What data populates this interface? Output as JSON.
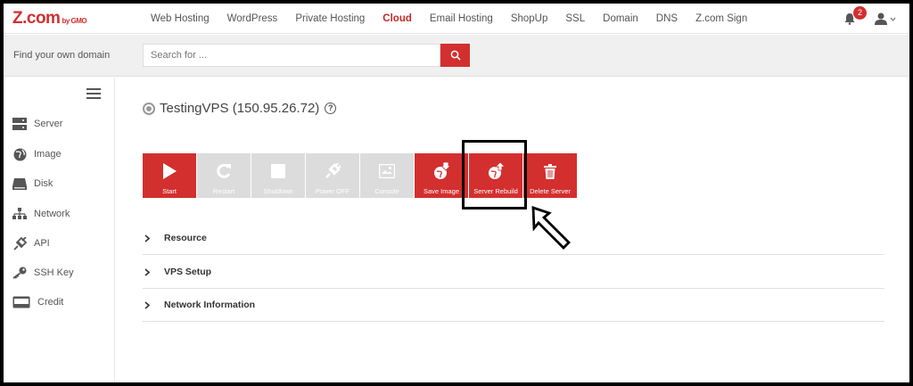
{
  "brand": {
    "logo": "Z.com",
    "logo_suffix": "by GMO"
  },
  "nav": {
    "items": [
      "Web Hosting",
      "WordPress",
      "Private Hosting",
      "Cloud",
      "Email Hosting",
      "ShopUp",
      "SSL",
      "Domain",
      "DNS",
      "Z.com Sign"
    ],
    "active": "Cloud",
    "notifications": "2"
  },
  "search": {
    "label": "Find your own domain",
    "placeholder": "Search for ..."
  },
  "sidebar": {
    "items": [
      {
        "label": "Server",
        "icon": "server-icon"
      },
      {
        "label": "Image",
        "icon": "globe-icon"
      },
      {
        "label": "Disk",
        "icon": "disk-icon"
      },
      {
        "label": "Network",
        "icon": "network-icon"
      },
      {
        "label": "API",
        "icon": "api-icon"
      },
      {
        "label": "SSH Key",
        "icon": "key-icon"
      },
      {
        "label": "Credit",
        "icon": "credit-card-icon"
      }
    ]
  },
  "vps": {
    "title": "TestingVPS (150.95.26.72)"
  },
  "toolbar": {
    "buttons": [
      {
        "label": "Start",
        "enabled": true,
        "icon": "play-icon"
      },
      {
        "label": "Restart",
        "enabled": false,
        "icon": "restart-icon"
      },
      {
        "label": "Shutdown",
        "enabled": false,
        "icon": "stop-icon"
      },
      {
        "label": "Power OFF",
        "enabled": false,
        "icon": "plug-icon"
      },
      {
        "label": "Console",
        "enabled": false,
        "icon": "console-icon"
      },
      {
        "label": "Save Image",
        "enabled": true,
        "icon": "save-image-icon"
      },
      {
        "label": "Server Rebuild",
        "enabled": true,
        "icon": "rebuild-icon"
      },
      {
        "label": "Delete Server",
        "enabled": true,
        "icon": "trash-icon"
      }
    ]
  },
  "sections": [
    "Resource",
    "VPS Setup",
    "Network Information"
  ],
  "colors": {
    "accent": "#d32f2f",
    "disabled": "#dcdcdc"
  }
}
